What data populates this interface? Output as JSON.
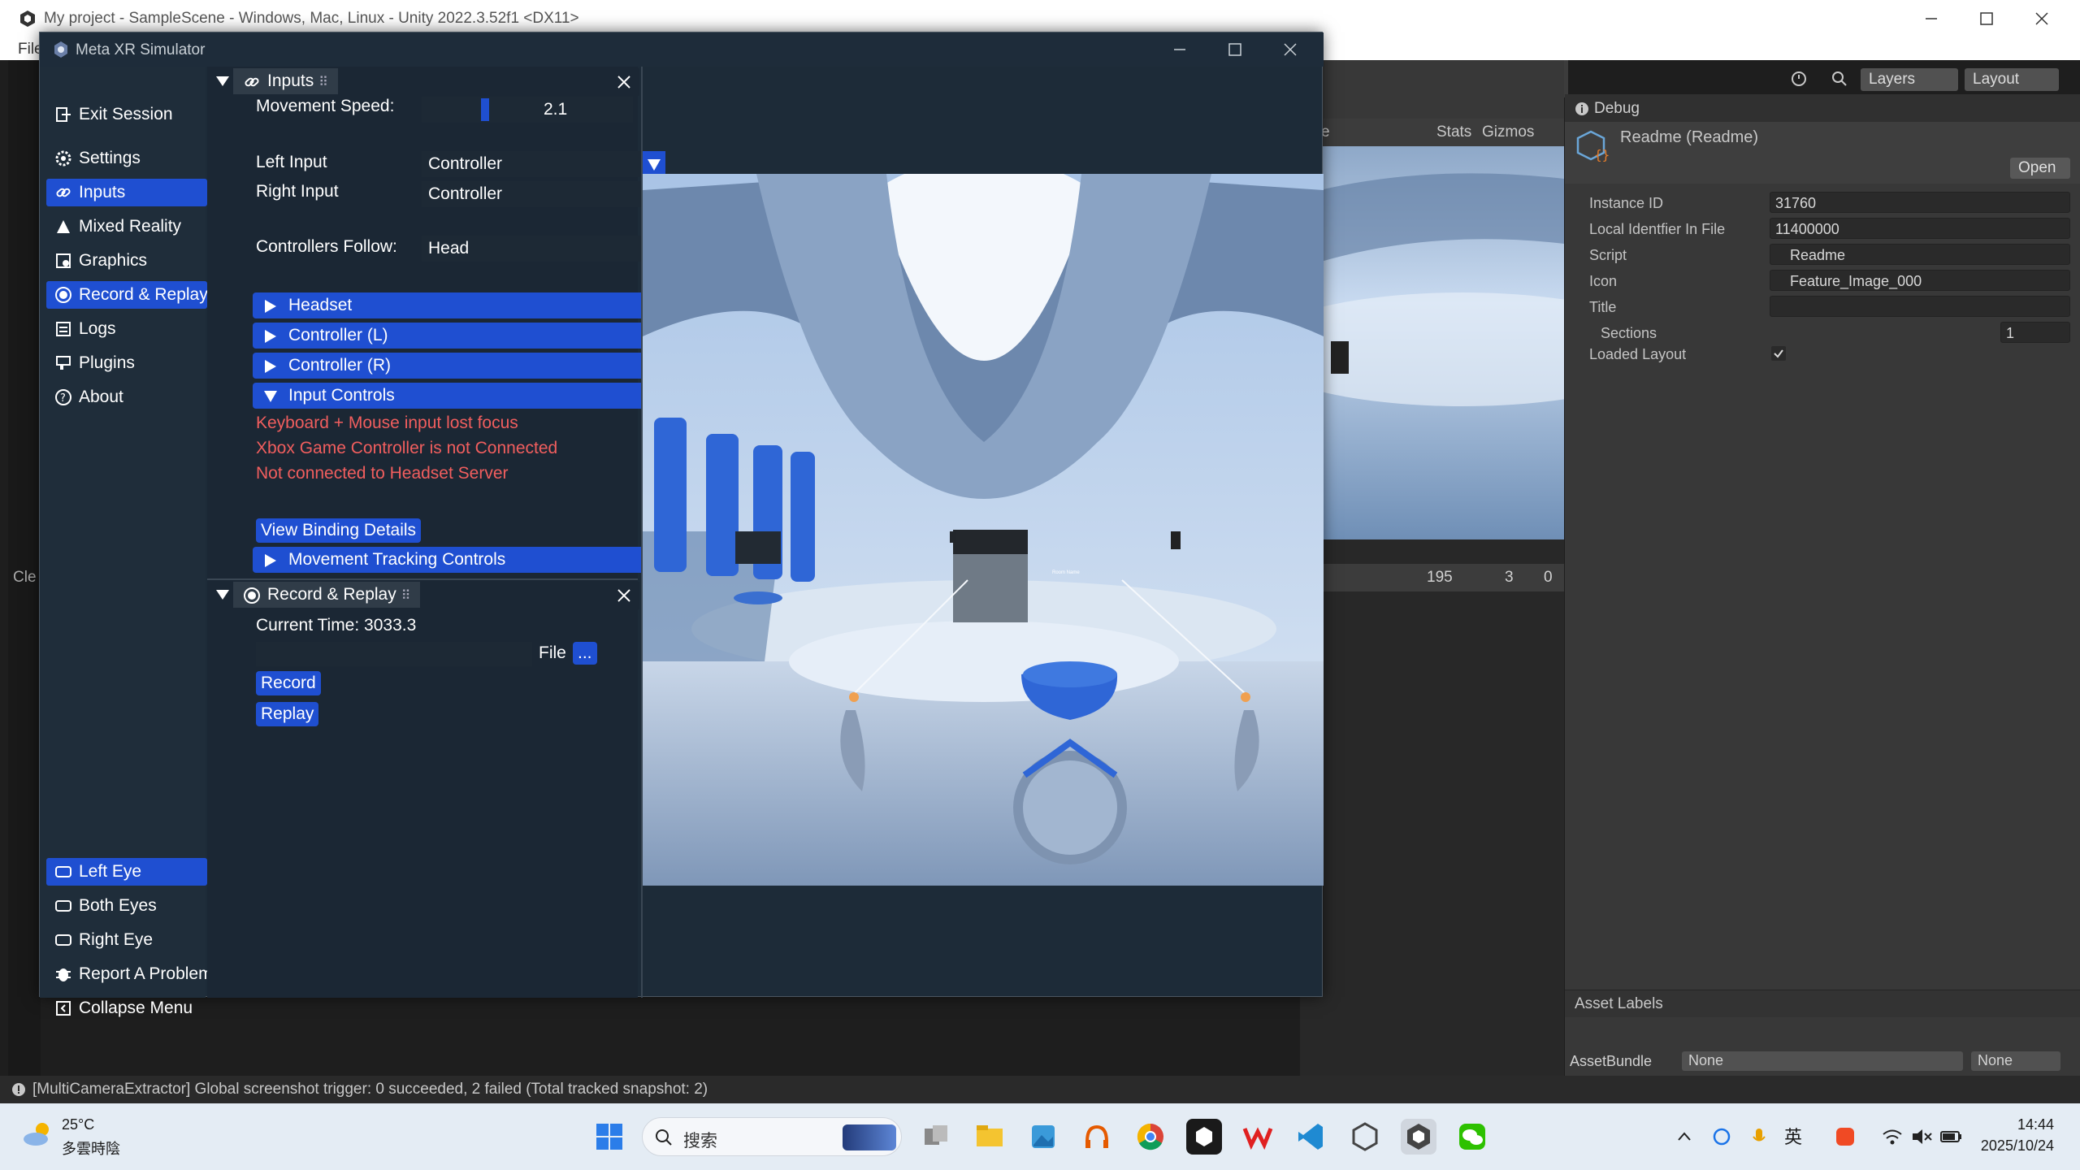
{
  "unity": {
    "title": "My project - SampleScene - Windows, Mac, Linux - Unity 2022.3.52f1 <DX11>",
    "menu_partial": "File",
    "toolbar": {
      "layers": "Layers",
      "layout": "Layout"
    },
    "scene_toolbar": {
      "stats": "Stats",
      "gizmos": "Gizmos",
      "partial": "e"
    },
    "console": {
      "info_count": "195",
      "warn_count": "3",
      "error_count": "0",
      "partial_label": "Cle"
    },
    "status_message": "[MultiCameraExtractor] Global screenshot trigger: 0 succeeded, 2 failed (Total tracked snapshot: 2)"
  },
  "inspector": {
    "tab": "Debug",
    "object_name": "Readme (Readme)",
    "open_button": "Open",
    "properties": [
      {
        "label": "Instance ID",
        "value": "31760"
      },
      {
        "label": "Local Identfier In File",
        "value": "11400000"
      },
      {
        "label": "Script",
        "value": "Readme"
      },
      {
        "label": "Icon",
        "value": "Feature_Image_000"
      },
      {
        "label": "Title",
        "value": ""
      }
    ],
    "sections_label": "Sections",
    "sections_value": "1",
    "loaded_layout_label": "Loaded Layout",
    "asset_labels": "Asset Labels",
    "asset_bundle_label": "AssetBundle",
    "asset_bundle_value": "None",
    "asset_bundle_variant": "None"
  },
  "simulator": {
    "title": "Meta XR Simulator",
    "nav": {
      "exit": "Exit Session",
      "settings": "Settings",
      "inputs": "Inputs",
      "mixed_reality": "Mixed Reality",
      "graphics": "Graphics",
      "record_replay": "Record & Replay",
      "logs": "Logs",
      "plugins": "Plugins",
      "about": "About",
      "left_eye": "Left Eye",
      "both_eyes": "Both Eyes",
      "right_eye": "Right Eye",
      "report": "Report A Problem",
      "collapse": "Collapse Menu"
    },
    "inputs_panel": {
      "title": "Inputs",
      "movement_speed_label": "Movement Speed:",
      "movement_speed_value": "2.1",
      "movement_speed_fraction": 0.3,
      "left_input_label": "Left Input",
      "left_input_value": "Controller",
      "right_input_label": "Right Input",
      "right_input_value": "Controller",
      "follow_label": "Controllers Follow:",
      "follow_value": "Head",
      "foldouts": [
        "Headset",
        "Controller (L)",
        "Controller (R)",
        "Input Controls"
      ],
      "warnings": [
        "Keyboard + Mouse input lost focus",
        "Xbox Game Controller is not Connected",
        "Not connected to Headset Server"
      ],
      "binding_button": "View Binding Details",
      "movement_foldout": "Movement Tracking Controls"
    },
    "record_panel": {
      "title": "Record & Replay",
      "current_time": "Current Time: 3033.3",
      "file_label": "File",
      "file_button": "...",
      "record_button": "Record",
      "replay_button": "Replay"
    },
    "viewport_popup": "Room Name"
  },
  "taskbar": {
    "temperature": "25°C",
    "weather": "多雲時陰",
    "search_placeholder": "搜索",
    "ime": "英",
    "time": "14:44",
    "date": "2025/10/24"
  },
  "colors": {
    "accent_blue": "#1f4fd1",
    "panel_bg": "#1b2734",
    "warning_red": "#f15e5e",
    "unity_bg": "#383838"
  }
}
